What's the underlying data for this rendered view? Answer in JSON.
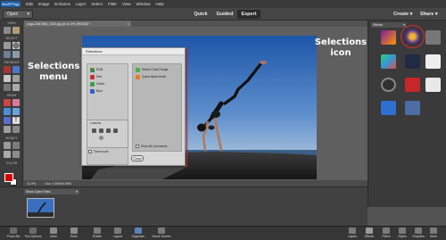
{
  "menubar": {
    "app_logo": "NewRPPage",
    "items": [
      "Edit",
      "Image",
      "Enhance",
      "Layer",
      "Select",
      "Filter",
      "View",
      "Window",
      "Help"
    ]
  },
  "modebar": {
    "open_label": "Open",
    "modes": [
      "Quick",
      "Guided",
      "Expert"
    ],
    "active_mode": "Expert",
    "create_label": "Create",
    "share_label": "Share"
  },
  "toolbar": {
    "sections": [
      "VIEW",
      "SELECT",
      "ENHANCE",
      "DRAW",
      "MODIFY",
      "COLOR"
    ],
    "fg_color": "#d10000",
    "bg_color": "#ffffff"
  },
  "document": {
    "tab_title": "yoga-2587466_1920.jpg @ 41.9% (RGB/8) *",
    "close_symbol": "×",
    "status_zoom": "41.9%",
    "status_doc": "Doc: 6.59M/6.59M"
  },
  "annotations": {
    "menu_label": "Selections menu",
    "menu_label_line1": "Selections",
    "menu_label_line2": "menu",
    "icon_label_line1": "Selections",
    "icon_label_line2": "icon"
  },
  "dialog": {
    "title": "Selections",
    "left_items": [
      "RGB",
      "Red",
      "Green",
      "Blue"
    ],
    "right_items": [
      "Select Color Range",
      "Quick Mask Mode"
    ],
    "load_label": "Load as",
    "checkbox_left": "Tonle mode",
    "checkbox_right": "Show All Commands",
    "close_label": "Close"
  },
  "right_panel": {
    "dropdown_label": "Effects"
  },
  "bin": {
    "dropdown_label": "Show Open Files"
  },
  "taskbar": {
    "items": [
      {
        "label": "Photo Bin",
        "icon": "photo-bin-icon"
      },
      {
        "label": "Tool Options",
        "icon": "tool-options-icon"
      },
      {
        "label": "Undo",
        "icon": "undo-icon"
      },
      {
        "label": "Redo",
        "icon": "redo-icon"
      },
      {
        "label": "Rotate",
        "icon": "rotate-icon"
      },
      {
        "label": "Layout",
        "icon": "layout-icon"
      },
      {
        "label": "Organizer",
        "icon": "organizer-icon"
      },
      {
        "label": "Home Screen",
        "icon": "home-screen-icon"
      },
      {
        "label": "Layers",
        "icon": "layers-icon"
      },
      {
        "label": "Effects",
        "icon": "effects-icon"
      },
      {
        "label": "Filters",
        "icon": "filters-icon"
      },
      {
        "label": "Styles",
        "icon": "styles-icon"
      },
      {
        "label": "Graphics",
        "icon": "graphics-icon"
      },
      {
        "label": "More",
        "icon": "more-icon"
      }
    ]
  },
  "colors": {
    "accent_red": "#e0283a",
    "selected_mode_bg": "#2b2b2b"
  }
}
